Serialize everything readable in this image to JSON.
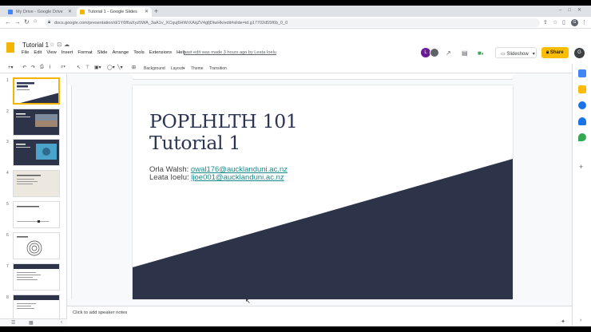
{
  "browser": {
    "tabs": [
      {
        "title": "My Drive - Google Drive",
        "favicon_color": "#4285f4",
        "active": false
      },
      {
        "title": "Tutorial 1 - Google Slides",
        "favicon_color": "#f4b400",
        "active": true
      }
    ],
    "new_tab": "+",
    "url": "docs.google.com/presentation/d/1Y6f6aXyz5WA_3aA1v_XCquj6HWrXAqZV4gfjDtwHk/edit#slide=id.g17702d55f6b_0_0"
  },
  "app": {
    "title": "Tutorial 1",
    "menu": [
      "File",
      "Edit",
      "View",
      "Insert",
      "Format",
      "Slide",
      "Arrange",
      "Tools",
      "Extensions",
      "Help"
    ],
    "last_edit": "Last edit was made 3 hours ago by Leata Ioelu",
    "collaborator_initial": "L",
    "user_initial": "G",
    "slideshow_label": "Slideshow",
    "share_label": "Share"
  },
  "toolbar": {
    "background": "Background",
    "layout": "Layout▾",
    "theme": "Theme",
    "transition": "Transition"
  },
  "filmstrip": {
    "numbers": [
      "1",
      "2",
      "3",
      "4",
      "5",
      "6",
      "7",
      "8"
    ]
  },
  "slide": {
    "title": "POPLHLTH 101\nTutorial 1",
    "credit1_label": "Orla Walsh: ",
    "credit1_email": "owal176@aucklanduni.ac.nz",
    "credit2_label": "Leata Ioelu: ",
    "credit2_email": "ljoe001@aucklanduni.ac.nz",
    "accent_color": "#2d3349",
    "title_color": "#2b3451"
  },
  "notes": {
    "placeholder": "Click to add speaker notes"
  }
}
